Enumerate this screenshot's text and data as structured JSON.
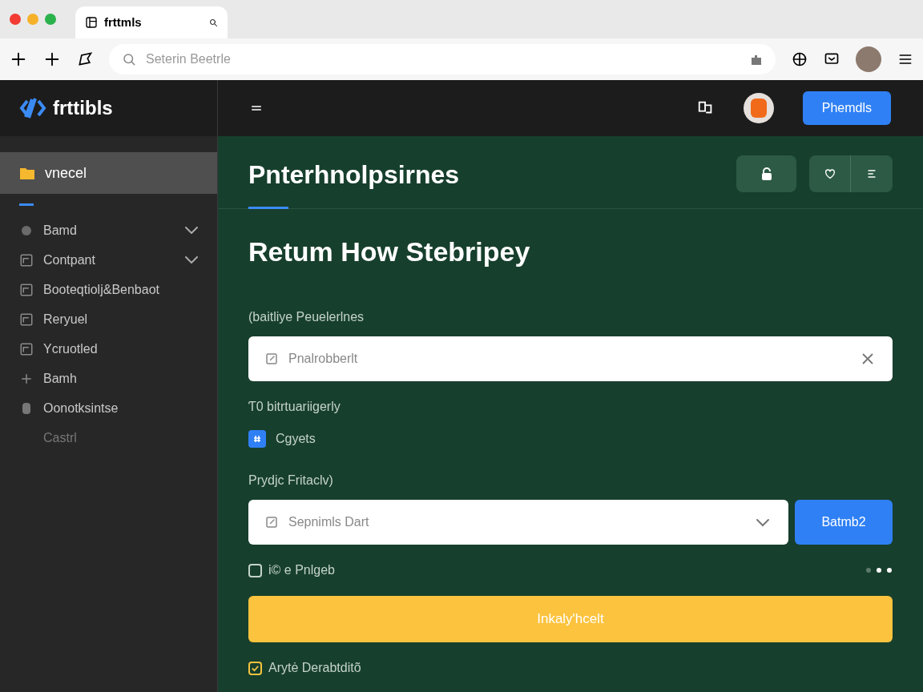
{
  "browser": {
    "tab_title": "frttmls",
    "address_placeholder": "Seterin Beetrle"
  },
  "app": {
    "logo": "frttibls",
    "header_button": "Phemdls"
  },
  "sidebar": {
    "items": [
      {
        "label": "vnecel",
        "selected": true,
        "chevron": false,
        "disabled": false
      },
      {
        "label": "Bamd",
        "selected": false,
        "chevron": true,
        "disabled": false
      },
      {
        "label": "Contpant",
        "selected": false,
        "chevron": true,
        "disabled": false
      },
      {
        "label": "Booteqtiolj&Benbaot",
        "selected": false,
        "chevron": false,
        "disabled": false
      },
      {
        "label": "Reryuel",
        "selected": false,
        "chevron": false,
        "disabled": false
      },
      {
        "label": "Ycruotled",
        "selected": false,
        "chevron": false,
        "disabled": false
      },
      {
        "label": "Bamh",
        "selected": false,
        "chevron": false,
        "disabled": false
      },
      {
        "label": "Oonotksintse",
        "selected": false,
        "chevron": false,
        "disabled": false
      },
      {
        "label": "Castrl",
        "selected": false,
        "chevron": false,
        "disabled": true
      }
    ]
  },
  "main": {
    "page_title": "Pnterhnolpsirnes",
    "heading": "Retum How Stebripey",
    "field_label": "(baitliye Peuelerlnes",
    "field_placeholder": "Pnalrobberlt",
    "section_label": "Ƭ0 bitrtuariigerly",
    "tag": "Cgyets",
    "select_label": "Prydjc Fritaclv)",
    "select_placeholder": "Sepnimls Dart",
    "select_button": "Batmb2",
    "checkboxes": [
      {
        "label": "i© e Pnlgeb",
        "checked": false
      },
      {
        "label": "Arytė Derabtditõ",
        "checked": true
      }
    ],
    "submit": "Inkaly'hcelt"
  }
}
